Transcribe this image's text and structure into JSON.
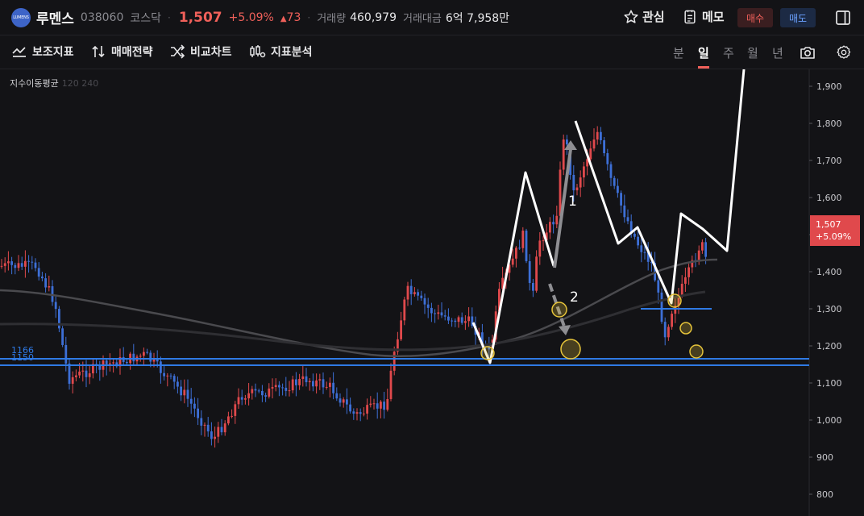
{
  "header": {
    "logo_text": "LUMENS",
    "stock_name": "루멘스",
    "stock_code": "038060",
    "market": "코스닥",
    "price": "1,507",
    "change_pct": "+5.09%",
    "change_amount": "73",
    "volume_label": "거래량",
    "volume": "460,979",
    "amount_label": "거래대금",
    "amount": "6억 7,958만",
    "interest_label": "관심",
    "memo_label": "메모",
    "buy_label": "매수",
    "sell_label": "매도"
  },
  "toolbar": {
    "indicator": "보조지표",
    "strategy": "매매전략",
    "compare": "비교차트",
    "analysis": "지표분석",
    "periods": [
      "분",
      "일",
      "주",
      "월",
      "년"
    ],
    "active_period": "일"
  },
  "chart": {
    "ma_label": "지수이동평균",
    "ma_periods": "120 240",
    "y_ticks": [
      "1,900",
      "1,800",
      "1,700",
      "1,600",
      "1,500",
      "1,400",
      "1,300",
      "1,200",
      "1,100",
      "1,000",
      "900",
      "800"
    ],
    "price_tag_value": "1,507",
    "price_tag_pct": "+5.09%",
    "support_label_1": "1166",
    "support_label_2": "1150",
    "annotation_1": "1",
    "annotation_2": "2"
  },
  "colors": {
    "up": "#e0494c",
    "down": "#3d6fd6",
    "support_line": "#2f7ae5",
    "zigzag": "#ffffff",
    "circle": "#e6c43a",
    "background": "#131316"
  }
}
